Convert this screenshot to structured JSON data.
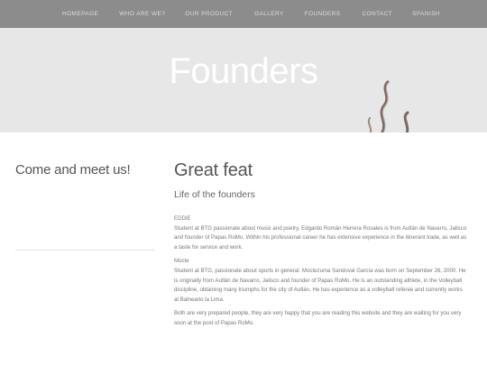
{
  "nav": {
    "items": [
      "HOMEPAGE",
      "WHO ARE WE?",
      "OUR PRODUCT",
      "GALLERY",
      "FOUNDERS",
      "CONTACT",
      "SPANISH"
    ]
  },
  "hero": {
    "title": "Founders",
    "decor_icon": "steam-icon"
  },
  "sidebar": {
    "heading": "Come and meet us!"
  },
  "main": {
    "title": "Great feat",
    "subtitle": "Life of the founders",
    "eddie": {
      "name": "EDDIE",
      "line1": "Student at BTG passionate about music and poetry, Edgardo Román Herrera Rosales is from Autlán de Navarro, Jalisco",
      "line2": "and founder of Papas RoMo. Within his professional career he has extensive experience in the itinerant trade, as well as",
      "line3": "a taste for service and work."
    },
    "mocte": {
      "name": "Mocte",
      "line1": "Student at BTG, passionate about sports in general. Moctezuma Sandoval García was born on September 26, 2000. He",
      "line2": "is originally from Autlán de Navarro, Jalisco and founder of Papas RoMo. He is an outstanding athlete, in the Volleyball",
      "line3": "discipline, obtaining many triumphs for the city of Autlán. He has experience as a volleyball referee and currently works",
      "line4": "at Balneario la Lima."
    },
    "closing": {
      "line1": "Both are very prepared people, they are very happy that you are reading this website and they are waiting for you very",
      "line2": "soon at the post of Papas RoMo."
    }
  },
  "colors": {
    "nav_bg": "#8c8c8c",
    "hero_bg": "#e7e7e7",
    "accent_brown": "#7a6a62"
  }
}
